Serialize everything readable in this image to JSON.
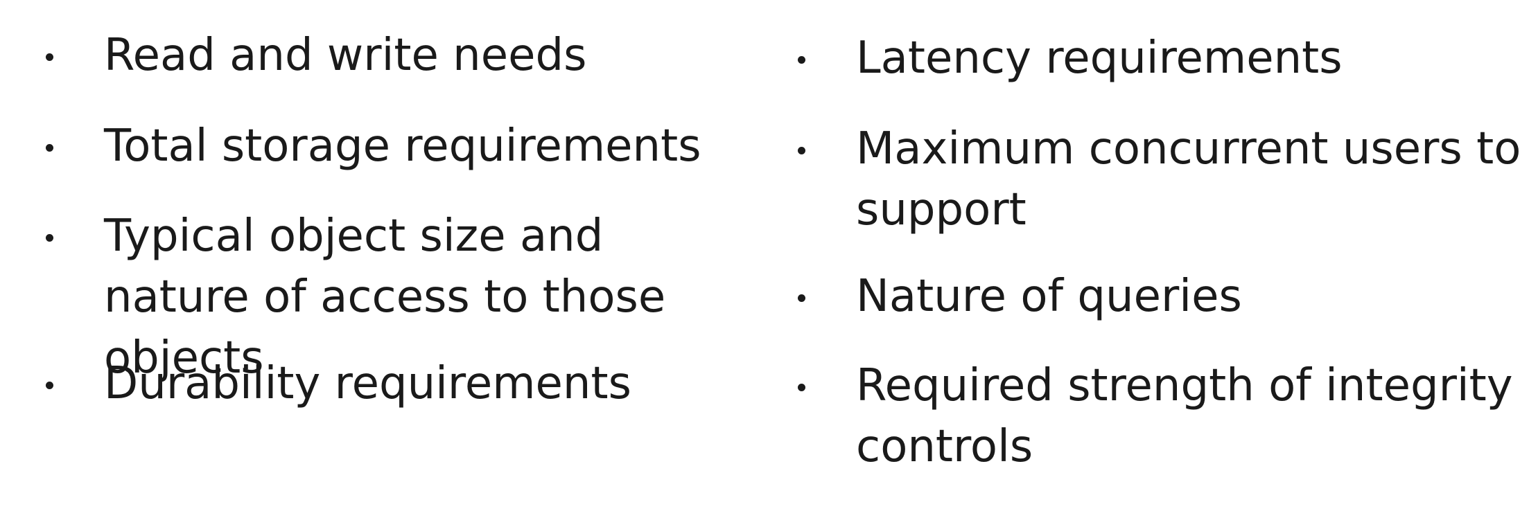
{
  "left_column": {
    "items": [
      "Read and write needs",
      "Total storage requirements",
      "Typical object size and nature of access to those objects",
      "Durability requirements"
    ]
  },
  "right_column": {
    "items": [
      "Latency requirements",
      "Maximum concurrent users to support",
      "Nature of queries",
      "Required strength of integrity controls"
    ]
  }
}
